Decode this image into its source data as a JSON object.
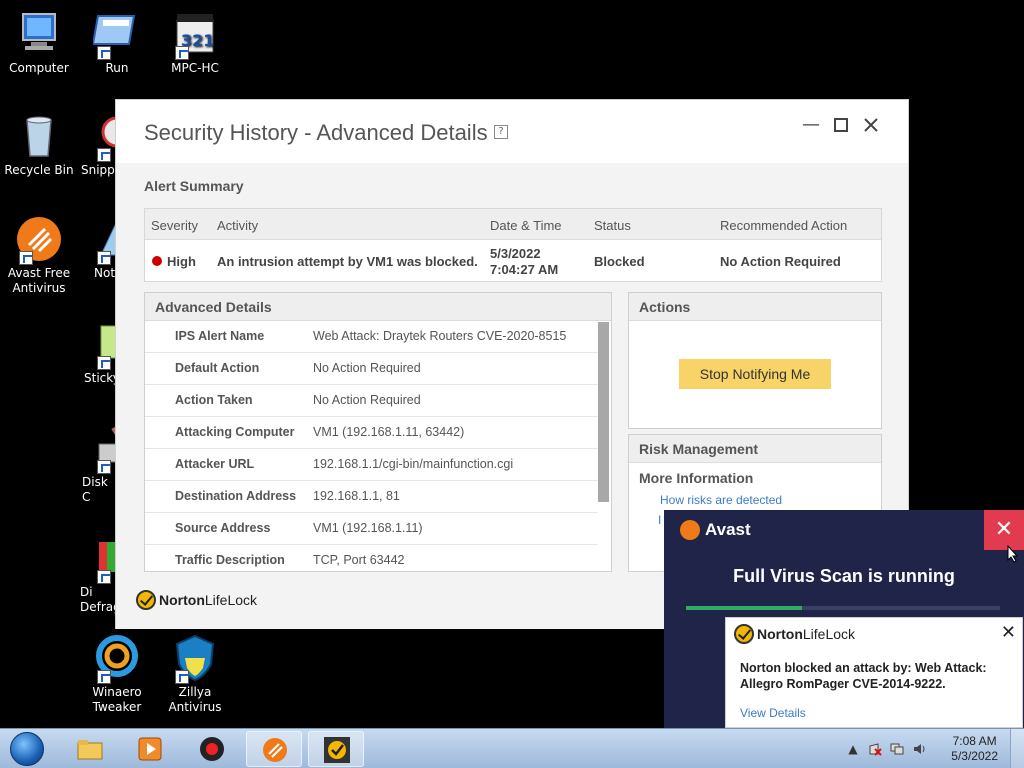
{
  "desktop": {
    "icons": [
      {
        "label": "Computer",
        "icon": "computer-icon"
      },
      {
        "label": "Run",
        "icon": "run-icon"
      },
      {
        "label": "MPC-HC",
        "icon": "mpc-hc-icon"
      },
      {
        "label": "Recycle Bin",
        "icon": "recycle-bin-icon"
      },
      {
        "label": "Snippi",
        "icon": "snipping-tool-icon"
      },
      {
        "label": "Avast Free Antivirus",
        "icon": "avast-icon"
      },
      {
        "label": "Not",
        "icon": "notepad-icon"
      },
      {
        "label": "Sticky",
        "icon": "sticky-notes-icon"
      },
      {
        "label": "Disk C",
        "icon": "disk-cleanup-icon"
      },
      {
        "label": "Di Defrag",
        "icon": "defrag-icon"
      },
      {
        "label": "Winaero Tweaker",
        "icon": "winaero-tweaker-icon"
      },
      {
        "label": "Zillya Antivirus",
        "icon": "zillya-icon"
      }
    ]
  },
  "window": {
    "title": "Security History - Advanced Details",
    "help": "?",
    "alert_summary_label": "Alert Summary",
    "alert_table": {
      "headers": [
        "Severity",
        "Activity",
        "Date & Time",
        "Status",
        "Recommended Action"
      ],
      "row": {
        "severity": "High",
        "activity": "An intrusion attempt by VM1 was blocked.",
        "date": "5/3/2022",
        "time": "7:04:27 AM",
        "status": "Blocked",
        "recommended": "No Action Required"
      }
    },
    "advanced_details": {
      "label": "Advanced Details",
      "rows": [
        {
          "key": "IPS Alert Name",
          "value": "Web Attack: Draytek Routers CVE-2020-8515"
        },
        {
          "key": "Default Action",
          "value": "No Action Required"
        },
        {
          "key": "Action Taken",
          "value": "No Action Required"
        },
        {
          "key": "Attacking Computer",
          "value": "VM1 (192.168.1.11, 63442)"
        },
        {
          "key": "Attacker URL",
          "value": "192.168.1.1/cgi-bin/mainfunction.cgi"
        },
        {
          "key": "Destination Address",
          "value": "192.168.1.1, 81"
        },
        {
          "key": "Source Address",
          "value": "VM1 (192.168.1.11)"
        },
        {
          "key": "Traffic Description",
          "value": "TCP, Port 63442"
        }
      ]
    },
    "actions": {
      "label": "Actions",
      "button": "Stop Notifying Me"
    },
    "risk": {
      "label": "Risk Management",
      "more_info": "More Information",
      "link1": "How risks are detected",
      "link2": "I"
    },
    "logo": {
      "norton": "Norton",
      "lifelock": "LifeLock"
    }
  },
  "avast_popup": {
    "brand": "Avast",
    "close": "✕",
    "scan_text": "Full Virus Scan is running",
    "progress": 0.37
  },
  "norton_notification": {
    "logo_norton": "Norton",
    "logo_lifelock": "LifeLock",
    "close": "✕",
    "message": "Norton blocked an attack by: Web Attack: Allegro RomPager CVE-2014-9222.",
    "link": "View Details"
  },
  "taskbar": {
    "time": "7:08 AM",
    "date": "5/3/2022"
  }
}
